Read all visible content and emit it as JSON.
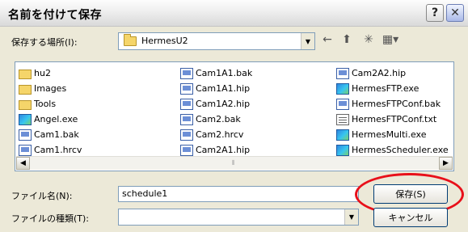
{
  "window": {
    "title": "名前を付けて保存",
    "help_label": "?",
    "close_label": "✕"
  },
  "location": {
    "label": "保存する場所(I):",
    "value": "HermesU2",
    "arrow": "▼"
  },
  "toolbar": {
    "back": "←",
    "up": "⬆",
    "new_folder": "✳",
    "views": "▦▾"
  },
  "files": {
    "column1": [
      {
        "name": "hu2",
        "icon": "folder"
      },
      {
        "name": "Images",
        "icon": "folder"
      },
      {
        "name": "Tools",
        "icon": "folder"
      },
      {
        "name": "Angel.exe",
        "icon": "exe"
      },
      {
        "name": "Cam1.bak",
        "icon": "doc"
      },
      {
        "name": "Cam1.hrcv",
        "icon": "doc"
      }
    ],
    "column2": [
      {
        "name": "Cam1A1.bak",
        "icon": "doc"
      },
      {
        "name": "Cam1A1.hip",
        "icon": "doc"
      },
      {
        "name": "Cam1A2.hip",
        "icon": "doc"
      },
      {
        "name": "Cam2.bak",
        "icon": "doc"
      },
      {
        "name": "Cam2.hrcv",
        "icon": "doc"
      },
      {
        "name": "Cam2A1.hip",
        "icon": "doc"
      }
    ],
    "column3": [
      {
        "name": "Cam2A2.hip",
        "icon": "doc"
      },
      {
        "name": "HermesFTP.exe",
        "icon": "exe"
      },
      {
        "name": "HermesFTPConf.bak",
        "icon": "doc"
      },
      {
        "name": "HermesFTPConf.txt",
        "icon": "txt"
      },
      {
        "name": "HermesMulti.exe",
        "icon": "exe"
      },
      {
        "name": "HermesScheduler.exe",
        "icon": "exe"
      }
    ]
  },
  "scrollbar": {
    "left": "◀",
    "right": "▶",
    "grip": "⦀"
  },
  "filename": {
    "label": "ファイル名(N):",
    "value": "schedule1"
  },
  "filetype": {
    "label": "ファイルの種類(T):",
    "value": "",
    "arrow": "▼"
  },
  "buttons": {
    "save": "保存(S)",
    "cancel": "キャンセル"
  },
  "colors": {
    "highlight_ring": "#e8101a",
    "field_border": "#7f9db9"
  }
}
